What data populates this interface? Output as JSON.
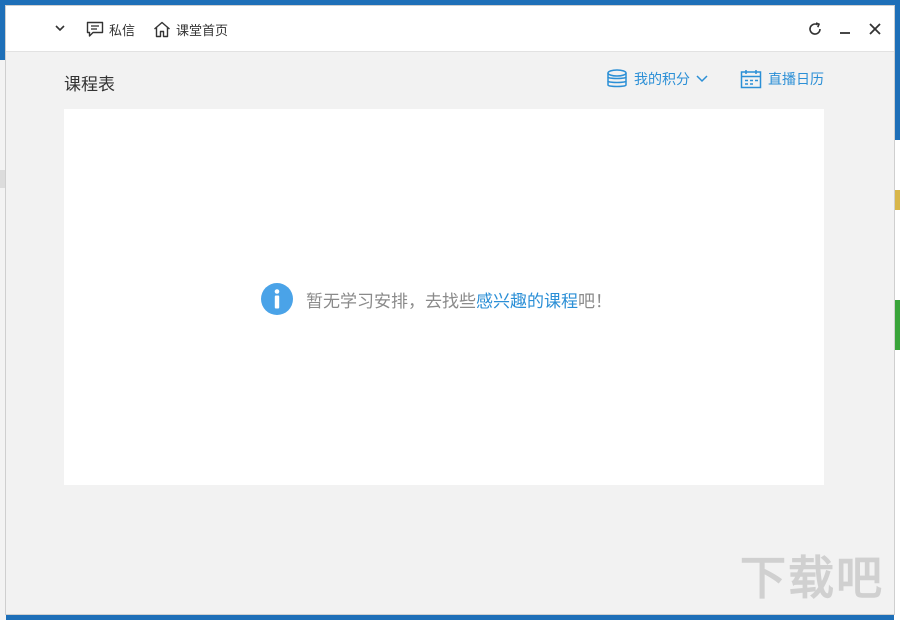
{
  "titlebar": {
    "messages_label": "私信",
    "home_label": "课堂首页"
  },
  "header": {
    "title": "课程表",
    "points_label": "我的积分",
    "calendar_label": "直播日历"
  },
  "empty_state": {
    "prefix": "暂无学习安排，去找些",
    "link_text": "感兴趣的课程",
    "suffix": "吧！"
  },
  "watermark": "下载吧",
  "colors": {
    "accent": "#2b8fd6",
    "info_icon": "#4aa3e8",
    "window_bg": "#f2f2f2",
    "content_bg": "#ffffff"
  }
}
